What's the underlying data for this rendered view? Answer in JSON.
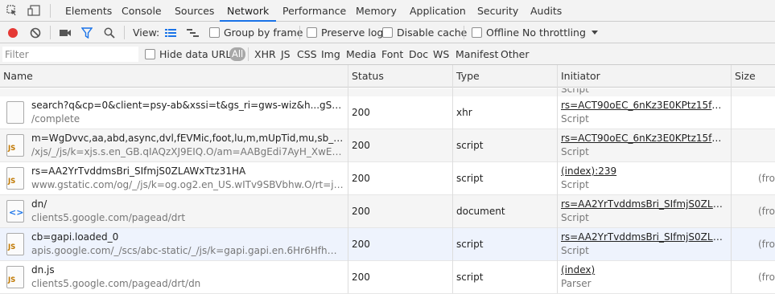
{
  "tabs": [
    "Elements",
    "Console",
    "Sources",
    "Network",
    "Performance",
    "Memory",
    "Application",
    "Security",
    "Audits"
  ],
  "active_tab": "Network",
  "toolbar": {
    "view_label": "View:",
    "group_by_frame": "Group by frame",
    "preserve_log": "Preserve log",
    "disable_cache": "Disable cache",
    "offline": "Offline",
    "throttling": "No throttling",
    "record_color": "#e53935",
    "filter_color": "#1a73e8"
  },
  "filter": {
    "placeholder": "Filter",
    "hide_data_urls": "Hide data URLs",
    "types": [
      "All",
      "XHR",
      "JS",
      "CSS",
      "Img",
      "Media",
      "Font",
      "Doc",
      "WS",
      "Manifest",
      "Other"
    ]
  },
  "columns": [
    "Name",
    "Status",
    "Type",
    "Initiator",
    "Size"
  ],
  "top_partial_initiator": "Script",
  "rows": [
    {
      "icon": "blank-file-icon",
      "name": "search?q&cp=0&client=psy-ab&xssi=t&gs_ri=gws-wiz&h...gSI56rICw.1...",
      "path": "/complete",
      "status": "200",
      "type": "xhr",
      "initiator": "rs=ACT90oEC_6nKz3E0KPtz15f1FHB...",
      "initiator_type": "Script",
      "size": ""
    },
    {
      "icon": "js-file-icon",
      "name": "m=WgDvvc,aa,abd,async,dvl,fEVMic,foot,lu,m,mUpTid,mu,sb_wiz,sf,soni...",
      "path": "/xjs/_/js/k=xjs.s.en_GB.qIAQzXJ9EIQ.O/am=AABgEdi7AyH_XwEAdgEAB...",
      "status": "200",
      "type": "script",
      "initiator": "rs=ACT90oEC_6nKz3E0KPtz15f1FHB...",
      "initiator_type": "Script",
      "size": ""
    },
    {
      "icon": "js-file-icon",
      "name": "rs=AA2YrTvddmsBri_SIfmjS0ZLAWxTtz31HA",
      "path": "www.gstatic.com/og/_/js/k=og.og2.en_US.wITv9SBVbhw.O/rt=j/m=drt,...",
      "status": "200",
      "type": "script",
      "initiator": "(index):239",
      "initiator_type": "Script",
      "size": "(fro"
    },
    {
      "icon": "document-icon",
      "name": "dn/",
      "path": "clients5.google.com/pagead/drt",
      "status": "200",
      "type": "document",
      "initiator": "rs=AA2YrTvddmsBri_SIfmjS0ZLAWxTt...",
      "initiator_type": "Script",
      "size": "(fro"
    },
    {
      "icon": "js-file-icon",
      "name": "cb=gapi.loaded_0",
      "path": "apis.google.com/_/scs/abc-static/_/js/k=gapi.gapi.en.6Hr6HfhQmkw.O/...",
      "status": "200",
      "type": "script",
      "initiator": "rs=AA2YrTvddmsBri_SIfmjS0ZLAWxTt...",
      "initiator_type": "Script",
      "size": "(fro"
    },
    {
      "icon": "js-file-icon",
      "name": "dn.js",
      "path": "clients5.google.com/pagead/drt/dn",
      "status": "200",
      "type": "script",
      "initiator": "(index)",
      "initiator_type": "Parser",
      "size": "(fro"
    }
  ]
}
